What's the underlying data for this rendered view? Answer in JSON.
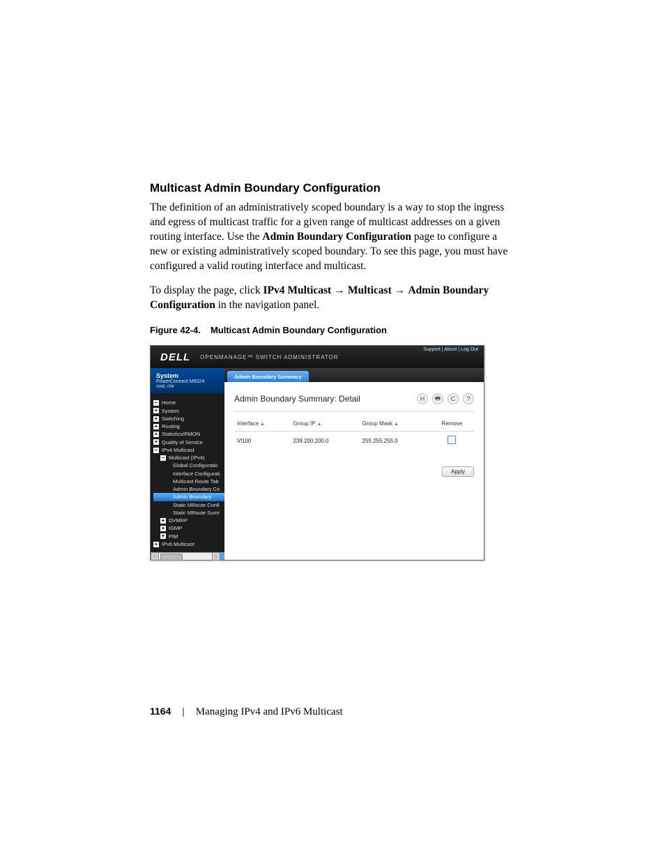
{
  "heading": "Multicast Admin Boundary Configuration",
  "para1_a": "The definition of an administratively scoped boundary is a way to stop the ingress and egress of multicast traffic for a given range of multicast addresses on a given routing interface. Use the ",
  "para1_bold1": "Admin Boundary Configuration",
  "para1_b": " page to configure a new or existing administratively scoped boundary. To see this page, you must have configured a valid routing interface and multicast.",
  "para2_a": "To display the page, click ",
  "para2_bold1": "IPv4 Multicast",
  "para2_bold2": "Multicast",
  "para2_bold3": "Admin Boundary Configuration",
  "para2_b": " in the navigation panel.",
  "fig_num": "Figure 42-4.",
  "fig_title": "Multicast Admin Boundary Configuration",
  "footer_page": "1164",
  "footer_chapter": "Managing IPv4 and IPv6 Multicast",
  "ss": {
    "brand": "DELL",
    "product": "OPENMANAGE™ SWITCH ADMINISTRATOR",
    "toplinks": "Support  |  About  |  Log Out",
    "system_label": "System",
    "system_model": "PowerConnect M8024",
    "system_user": "root, r/w",
    "nav": {
      "home": "Home",
      "system": "System",
      "switching": "Switching",
      "routing": "Routing",
      "stats": "Statistics/RMON",
      "qos": "Quality of Service",
      "ipv4mc": "IPv4 Multicast",
      "multicast": "Multicast (IPv4)",
      "globalcfg": "Global Configuratio",
      "ifacecfg": "Interface Configurati",
      "mrtab": "Multicast Route Tab",
      "abco": "Admin Boundary Co",
      "absum": "Admin Boundary",
      "smrc": "Static MRoute Confi",
      "smrs": "Static MRoute Sumr",
      "dvmrp": "DVMRP",
      "igmp": "IGMP",
      "pim": "PIM",
      "ipv6mc": "IPv6 Multicast"
    },
    "tab": "Admin Boundary Summary",
    "panel_title": "Admin Boundary Summary: Detail",
    "cols": {
      "iface": "Interface",
      "gip": "Group IP",
      "gmask": "Group Mask",
      "remove": "Remove"
    },
    "row": {
      "iface": "Vl100",
      "gip": "239.200.200.0",
      "gmask": "255.255.255.0"
    },
    "apply": "Apply"
  }
}
